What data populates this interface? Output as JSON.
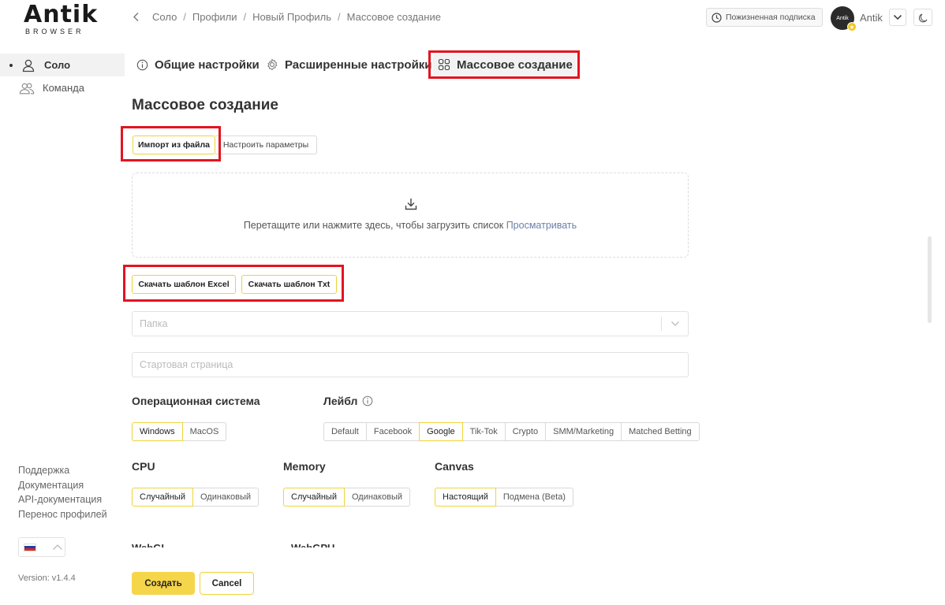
{
  "app": {
    "logo_text": "Antik",
    "logo_sub": "BROWSER",
    "version": "Version: v1.4.4"
  },
  "sidebar": {
    "items": [
      {
        "label": "Соло",
        "icon": "user-icon",
        "active": true
      },
      {
        "label": "Команда",
        "icon": "team-icon",
        "active": false
      }
    ],
    "links": [
      "Поддержка",
      "Документация",
      "API-документация",
      "Перенос профилей"
    ],
    "language_flag": "ru-flag-icon"
  },
  "breadcrumb": [
    "Соло",
    "Профили",
    "Новый Профиль",
    "Массовое создание"
  ],
  "topbar": {
    "subscription_label": "Пожизненная подписка",
    "user_name": "Antik",
    "avatar_text": "Antik"
  },
  "tabs": [
    {
      "label": "Общие настройки",
      "icon": "info-icon"
    },
    {
      "label": "Расширенные настройки",
      "icon": "gear-icon"
    },
    {
      "label": "Массовое создание",
      "icon": "grid-icon",
      "active": true
    }
  ],
  "page_title": "Массовое создание",
  "import": {
    "from_file": "Импорт из файла",
    "configure": "Настроить параметры"
  },
  "dropzone": {
    "text": "Перетащите или нажмите здесь, чтобы загрузить список",
    "link": "Просматривать"
  },
  "templates": {
    "excel": "Скачать шаблон Excel",
    "txt": "Скачать шаблон Txt"
  },
  "fields": {
    "folder_placeholder": "Папка",
    "start_page_placeholder": "Стартовая страница"
  },
  "os": {
    "label": "Операционная система",
    "options": [
      "Windows",
      "MacOS"
    ],
    "selected": "Windows"
  },
  "label_group": {
    "label": "Лейбл",
    "options": [
      "Default",
      "Facebook",
      "Google",
      "Tik-Tok",
      "Crypto",
      "SMM/Marketing",
      "Matched Betting"
    ],
    "selected": "Google"
  },
  "cpu": {
    "label": "CPU",
    "options": [
      "Случайный",
      "Одинаковый"
    ],
    "selected": "Случайный"
  },
  "memory": {
    "label": "Memory",
    "options": [
      "Случайный",
      "Одинаковый"
    ],
    "selected": "Случайный"
  },
  "canvas": {
    "label": "Canvas",
    "options": [
      "Настоящий",
      "Подмена (Beta)"
    ],
    "selected": "Настоящий"
  },
  "cut_off": {
    "left": "WebGL",
    "right": "WebGPU"
  },
  "actions": {
    "create": "Создать",
    "cancel": "Cancel"
  },
  "colors": {
    "accent": "#f5d54a",
    "accent_border": "#f0d33b",
    "highlight_red": "#e3141f"
  }
}
